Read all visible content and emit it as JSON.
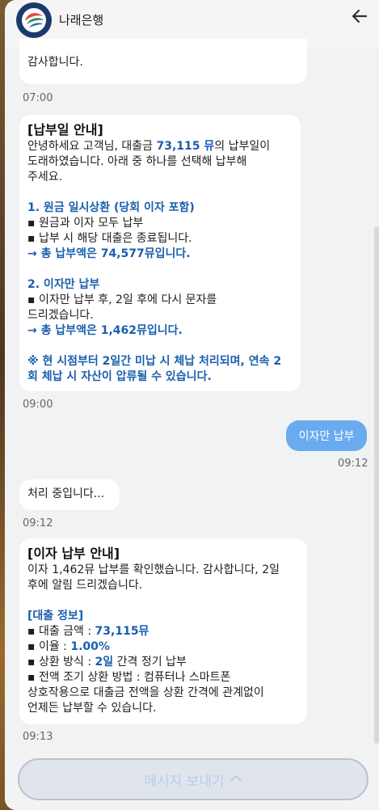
{
  "header": {
    "bank_name": "나래은행",
    "logo_icon": "bank-logo-icon",
    "back_icon": "arrow-left-icon"
  },
  "messages": {
    "m1": {
      "text": "감사합니다.",
      "time": "07:00"
    },
    "m2": {
      "title": "[납부일 안내]",
      "intro1_pre": "안녕하세요 고객님, 대출금 ",
      "intro1_amount": "73,115 뮤",
      "intro1_post": "의 납부일이",
      "intro2": "도래하였습니다. 아래 중 하나를 선택해 납부해",
      "intro3": "주세요.",
      "opt1_title": "1. 원금 일시상환 (당회 이자 포함)",
      "opt1_l1": "▪ 원금과 이자 모두 납부",
      "opt1_l2": "▪ 납부 시 해당 대출은 종료됩니다.",
      "opt1_total": "→ 총 납부액은 74,577뮤입니다.",
      "opt2_title": "2. 이자만 납부",
      "opt2_l1": "▪ 이자만 납부 후, 2일 후에 다시 문자를",
      "opt2_l2": "드리겠습니다.",
      "opt2_total": "→ 총 납부액은 1,462뮤입니다.",
      "warn1": "※ 현 시점부터 2일간 미납 시 체납 처리되며, 연속 2",
      "warn2": "회 체납 시 자산이 압류될 수 있습니다.",
      "time": "09:00"
    },
    "m3": {
      "text": "이자만 납부",
      "time": "09:12"
    },
    "m4": {
      "text": "처리 중입니다...",
      "time": "09:12"
    },
    "m5": {
      "title": "[이자 납부 안내]",
      "l1": "이자 1,462뮤 납부를 확인했습니다. 감사합니다, 2일",
      "l2": "후에 알림 드리겠습니다.",
      "info_title": "[대출 정보]",
      "amount_label": "▪ 대출 금액 : ",
      "amount_value": "73,115뮤",
      "rate_label": "▪ 이율 : ",
      "rate_value": "1.00%",
      "method_label": "▪ 상환 방식 : ",
      "method_value": "2일",
      "method_post": " 간격 정기 납부",
      "early_label": "▪ 전액 조기 상환 방법 : 컴퓨터나 스마트폰",
      "early_l2": "상호작용으로 대출금 전액을 상환 간격에 관계없이",
      "early_l3": "언제든 납부할 수 있습니다.",
      "time": "09:13"
    }
  },
  "footer": {
    "send_label": "메시지 보내기",
    "send_icon": "chevron-up-icon"
  },
  "colors": {
    "accent_blue": "#1a5fae",
    "my_bubble": "#6aabf0",
    "send_text": "#b7ccec"
  }
}
